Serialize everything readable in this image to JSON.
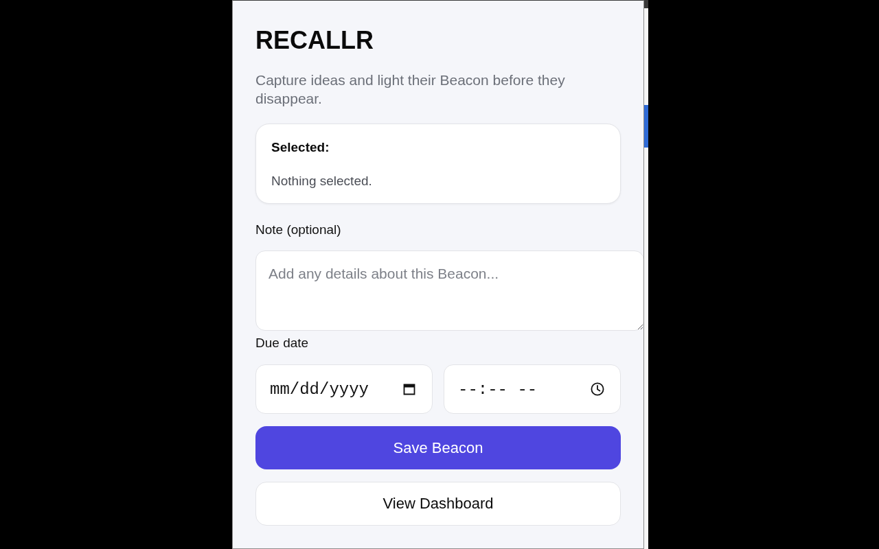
{
  "app": {
    "title": "RECALLR",
    "tagline": "Capture ideas and light their Beacon before they disappear."
  },
  "selection_card": {
    "heading": "Selected:",
    "value": "Nothing selected."
  },
  "note": {
    "label": "Note (optional)",
    "placeholder": "Add any details about this Beacon..."
  },
  "due_date": {
    "label": "Due date",
    "date": {
      "placeholder": "mm/dd/yyyy"
    },
    "time": {
      "placeholder": "--:-- --"
    }
  },
  "buttons": [
    {
      "label": "Save Beacon",
      "kind": "primary"
    },
    {
      "label": "View Dashboard",
      "kind": "secondary"
    }
  ]
}
